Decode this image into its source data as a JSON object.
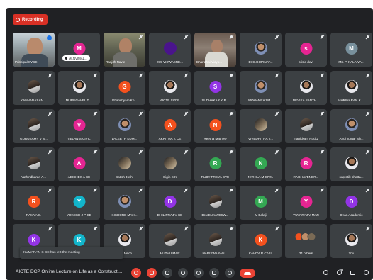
{
  "recording": {
    "label": "Recording"
  },
  "colors": {
    "accent_red": "#d93025",
    "tile_bg": "#3c4043",
    "frame_bg": "#202124",
    "speaking_blue": "#1a73e8"
  },
  "participants": [
    {
      "name": "Principal SVCE",
      "kind": "video",
      "video": "v1",
      "speaking": true
    },
    {
      "name": "Mr.NVIMAL...",
      "kind": "letter",
      "initial": "M",
      "color": "#e52592",
      "pill": true
    },
    {
      "name": "Ranjith Ravie",
      "kind": "video",
      "video": "v2"
    },
    {
      "name": "079 VISWASRE...",
      "kind": "photo",
      "photo": "d",
      "color": "#4a148c"
    },
    {
      "name": "Bharathai Vidya...",
      "kind": "video",
      "video": "v3"
    },
    {
      "name": "Dr.C.GOPINAT...",
      "kind": "photo",
      "photo": "c"
    },
    {
      "name": "srisia devi",
      "kind": "letter",
      "initial": "s",
      "color": "#e52592"
    },
    {
      "name": "Ms. P. KALAIVA...",
      "kind": "letter",
      "initial": "M",
      "color": "#78909c"
    },
    {
      "name": "KANNADASAN ...",
      "kind": "photo",
      "photo": "a"
    },
    {
      "name": "MURUGAVEL T ...",
      "kind": "photo",
      "photo": "b"
    },
    {
      "name": "Ghanshyam Ko...",
      "kind": "letter",
      "initial": "G",
      "color": "#f4511e"
    },
    {
      "name": "AICTE SVCE",
      "kind": "photo",
      "photo": "b"
    },
    {
      "name": "SUDHAKAR K B...",
      "kind": "letter",
      "initial": "S",
      "color": "#9334e6"
    },
    {
      "name": "MOHANRAJ M...",
      "kind": "photo",
      "photo": "c"
    },
    {
      "name": "DEVIKA SANTH...",
      "kind": "photo",
      "photo": "b"
    },
    {
      "name": "HARIHARAN K ...",
      "kind": "photo",
      "photo": "b"
    },
    {
      "name": "GURUSAMY V S...",
      "kind": "photo",
      "photo": "a"
    },
    {
      "name": "VELAN S CIVIL",
      "kind": "letter",
      "initial": "V",
      "color": "#e52592"
    },
    {
      "name": "LALEETH KUM...",
      "kind": "photo",
      "photo": "c"
    },
    {
      "name": "AKRITHA K CE",
      "kind": "letter",
      "initial": "A",
      "color": "#f4511e"
    },
    {
      "name": "Reetha Mathew",
      "kind": "letter",
      "initial": "N",
      "color": "#f4511e"
    },
    {
      "name": "VIVEDHITHA V...",
      "kind": "photo",
      "photo": "d"
    },
    {
      "name": "manickam Rockz",
      "kind": "photo",
      "photo": "a"
    },
    {
      "name": "Anuj kumar Sh...",
      "kind": "photo",
      "photo": "c"
    },
    {
      "name": "Yathindharan A...",
      "kind": "photo",
      "photo": "a"
    },
    {
      "name": "ABISHEK A CE",
      "kind": "letter",
      "initial": "A",
      "color": "#e52592"
    },
    {
      "name": "Satish Joshi",
      "kind": "photo",
      "photo": "d"
    },
    {
      "name": "Cigin S K",
      "kind": "photo",
      "photo": "d"
    },
    {
      "name": "RUBY FREYA CVE",
      "kind": "letter",
      "initial": "R",
      "color": "#34a853"
    },
    {
      "name": "NITHILA M CIVIL",
      "kind": "letter",
      "initial": "N",
      "color": "#34a853"
    },
    {
      "name": "RAGHAVENDR...",
      "kind": "letter",
      "initial": "R",
      "color": "#e52592"
    },
    {
      "name": "supratik bhatta...",
      "kind": "photo",
      "photo": "b"
    },
    {
      "name": "RAMYA C.",
      "kind": "letter",
      "initial": "R",
      "color": "#f4511e"
    },
    {
      "name": "YOKESH J P CE",
      "kind": "letter",
      "initial": "Y",
      "color": "#12b5cb"
    },
    {
      "name": "KISHORE MAH...",
      "kind": "photo",
      "photo": "c"
    },
    {
      "name": "DHILIPRAJ V CE",
      "kind": "letter",
      "initial": "D",
      "color": "#9334e6"
    },
    {
      "name": "Dr.VENKATESW...",
      "kind": "photo",
      "photo": "a"
    },
    {
      "name": "M Balaji",
      "kind": "letter",
      "initial": "M",
      "color": "#34a853"
    },
    {
      "name": "YUVARAJ V MAR",
      "kind": "letter",
      "initial": "Y",
      "color": "#e52592"
    },
    {
      "name": "Dean Academic",
      "kind": "letter",
      "initial": "D",
      "color": "#9334e6"
    },
    {
      "name": "DHARANIDHAR...",
      "kind": "letter",
      "initial": "K",
      "color": "#9334e6"
    },
    {
      "name": "KAILASH PRI...",
      "kind": "letter",
      "initial": "K",
      "color": "#12b5cb"
    },
    {
      "name": "Hod Mech",
      "kind": "photo",
      "photo": "b"
    },
    {
      "name": "MUTHU MAR",
      "kind": "photo",
      "photo": "a"
    },
    {
      "name": "HARISWARAN ...",
      "kind": "photo",
      "photo": "a"
    },
    {
      "name": "KAVIYA R CIVIL",
      "kind": "letter",
      "initial": "K",
      "color": "#f4511e"
    },
    {
      "name": "31 others",
      "kind": "others"
    },
    {
      "name": "You",
      "kind": "photo",
      "photo": "b"
    }
  ],
  "toast": {
    "text": "KUMARAN S CE has left the meeting"
  },
  "bottom_bar": {
    "meeting_title": "AICTE DCP Online Lecture on Life as a Constructi...",
    "controls": [
      "mic-off-icon",
      "camera-icon",
      "captions-icon",
      "raise-hand-icon",
      "emoji-icon",
      "present-icon",
      "more-options-icon",
      "hang-up-icon"
    ],
    "right_icons": [
      "info-icon",
      "people-icon",
      "chat-icon",
      "activities-icon"
    ],
    "people_count": "78"
  }
}
